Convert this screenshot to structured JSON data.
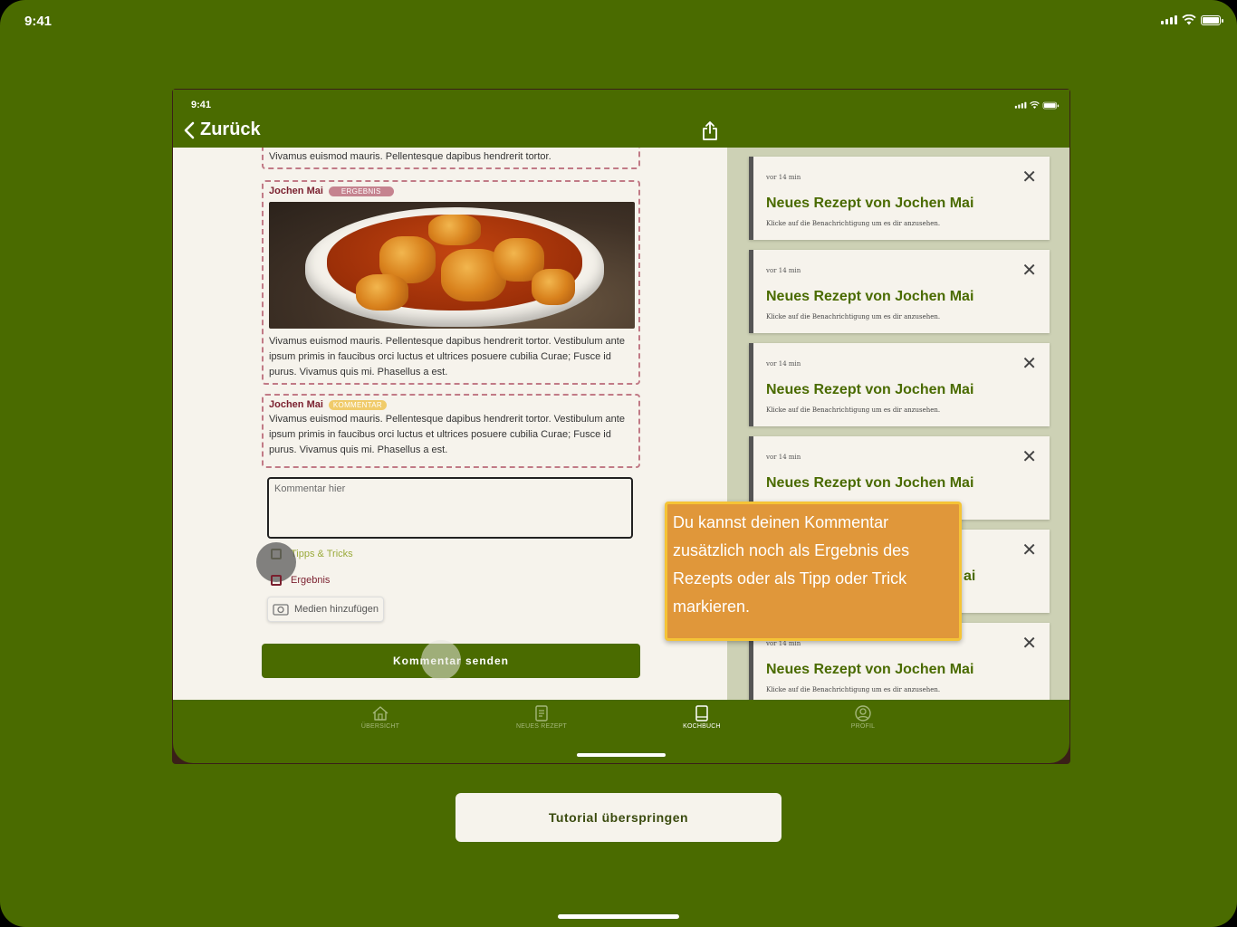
{
  "status_bar": {
    "time": "9:41"
  },
  "inner_status_bar": {
    "time": "9:41"
  },
  "nav": {
    "back_label": "Zurück",
    "share_icon": "share-icon"
  },
  "cards": [
    {
      "text": "Vivamus euismod mauris. Pellentesque dapibus hendrerit tortor."
    },
    {
      "author": "Jochen Mai",
      "badge": "ERGEBNIS",
      "image": "currywurst-photo",
      "text": "Vivamus euismod mauris. Pellentesque dapibus hendrerit tortor. Vestibulum ante ipsum primis in faucibus orci luctus et ultrices posuere cubilia Curae; Fusce id purus. Vivamus quis mi. Phasellus a est."
    },
    {
      "author": "Jochen Mai",
      "badge": "KOMMENTAR",
      "text": "Vivamus euismod mauris. Pellentesque dapibus hendrerit tortor. Vestibulum ante ipsum primis in faucibus orci luctus et ultrices posuere cubilia Curae; Fusce id purus. Vivamus quis mi. Phasellus a est."
    }
  ],
  "comment_form": {
    "placeholder": "Kommentar hier",
    "tips_label": "Tipps & Tricks",
    "ergebnis_label": "Ergebnis",
    "media_label": "Medien hinzufügen",
    "send_label": "Kommentar senden"
  },
  "notifications": [
    {
      "time": "vor 14 min",
      "title": "Neues Rezept von Jochen Mai",
      "subtitle": "Klicke auf die Benachrichtigung um es dir anzusehen."
    },
    {
      "time": "vor 14 min",
      "title": "Neues Rezept von Jochen Mai",
      "subtitle": "Klicke auf die Benachrichtigung um es dir anzusehen."
    },
    {
      "time": "vor 14 min",
      "title": "Neues Rezept von Jochen Mai",
      "subtitle": "Klicke auf die Benachrichtigung um es dir anzusehen."
    },
    {
      "time": "vor 14 min",
      "title": "Neues Rezept von Jochen Mai",
      "subtitle": ""
    },
    {
      "time": "",
      "title": "ai",
      "subtitle": ""
    },
    {
      "time": "vor 14 min",
      "title": "Neues Rezept von Jochen Mai",
      "subtitle": "Klicke auf die Benachrichtigung um es dir anzusehen."
    }
  ],
  "tooltip": {
    "text": "Du kannst deinen Kommentar zusätzlich noch als Ergebnis des Rezepts oder als Tipp oder Trick markieren."
  },
  "tabbar": {
    "tabs": [
      {
        "label": "ÜBERSICHT",
        "icon": "home-icon",
        "active": false
      },
      {
        "label": "NEUES REZEPT",
        "icon": "new-recipe-icon",
        "active": false
      },
      {
        "label": "KOCHBUCH",
        "icon": "cookbook-icon",
        "active": true
      },
      {
        "label": "PROFIL",
        "icon": "profile-icon",
        "active": false
      }
    ]
  },
  "skip_button": {
    "label": "Tutorial überspringen"
  },
  "colors": {
    "brand_green": "#4a6b00",
    "tooltip_orange": "#e0973a",
    "tooltip_border": "#f5c436",
    "accent_wine": "#7a1f2e"
  }
}
